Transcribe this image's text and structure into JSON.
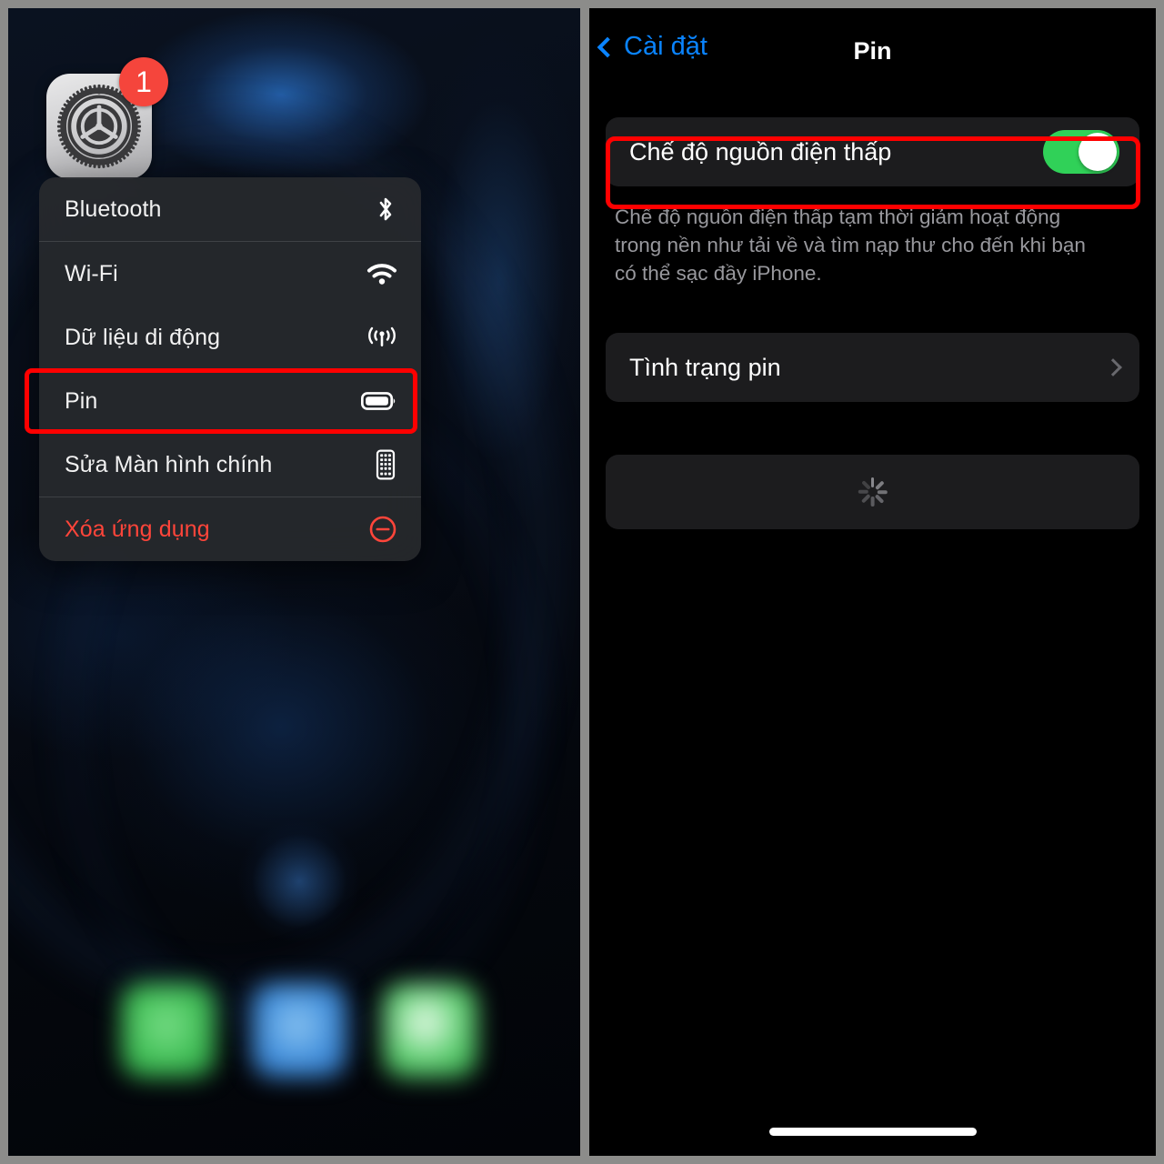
{
  "left_panel": {
    "app_icon": {
      "name": "Settings",
      "icon": "gear-icon",
      "badge_count": "1"
    },
    "context_menu": {
      "items": [
        {
          "label": "Bluetooth",
          "icon": "bluetooth-icon",
          "destructive": false,
          "highlighted": false
        },
        {
          "label": "Wi-Fi",
          "icon": "wifi-icon",
          "destructive": false,
          "highlighted": false
        },
        {
          "label": "Dữ liệu di động",
          "icon": "cellular-antenna-icon",
          "destructive": false,
          "highlighted": false
        },
        {
          "label": "Pin",
          "icon": "battery-icon",
          "destructive": false,
          "highlighted": true
        },
        {
          "label": "Sửa Màn hình chính",
          "icon": "home-screen-grid-icon",
          "destructive": false,
          "highlighted": false
        },
        {
          "label": "Xóa ứng dụng",
          "icon": "minus-circle-icon",
          "destructive": true,
          "highlighted": false
        }
      ]
    },
    "dock": {
      "icons": [
        "green-app-icon",
        "blue-app-icon",
        "green-app-icon"
      ]
    }
  },
  "right_panel": {
    "nav": {
      "back_label": "Cài đặt",
      "back_icon": "chevron-left-icon",
      "title": "Pin"
    },
    "low_power_mode": {
      "label": "Chế độ nguồn điện thấp",
      "toggle_state": "on",
      "highlighted": true,
      "description": "Chế độ nguồn điện thấp tạm thời giảm hoạt động trong nền như tải về và tìm nạp thư cho đến khi bạn có thể sạc đầy iPhone."
    },
    "battery_health": {
      "label": "Tình trạng pin",
      "accessory": "chevron-right-icon"
    },
    "loading_card": {
      "indicator": "activity-spinner-icon"
    },
    "home_indicator": "home-indicator-bar"
  },
  "annotations": {
    "highlight_color": "#ff0000",
    "highlight_targets": [
      "Pin",
      "Chế độ nguồn điện thấp"
    ]
  },
  "colors": {
    "accent_blue": "#0a84ff",
    "toggle_green": "#30d158",
    "destructive_red": "#ff453a",
    "badge_red": "#f5453c",
    "card_bg": "#1c1c1e",
    "footnote_gray": "#98989d"
  }
}
